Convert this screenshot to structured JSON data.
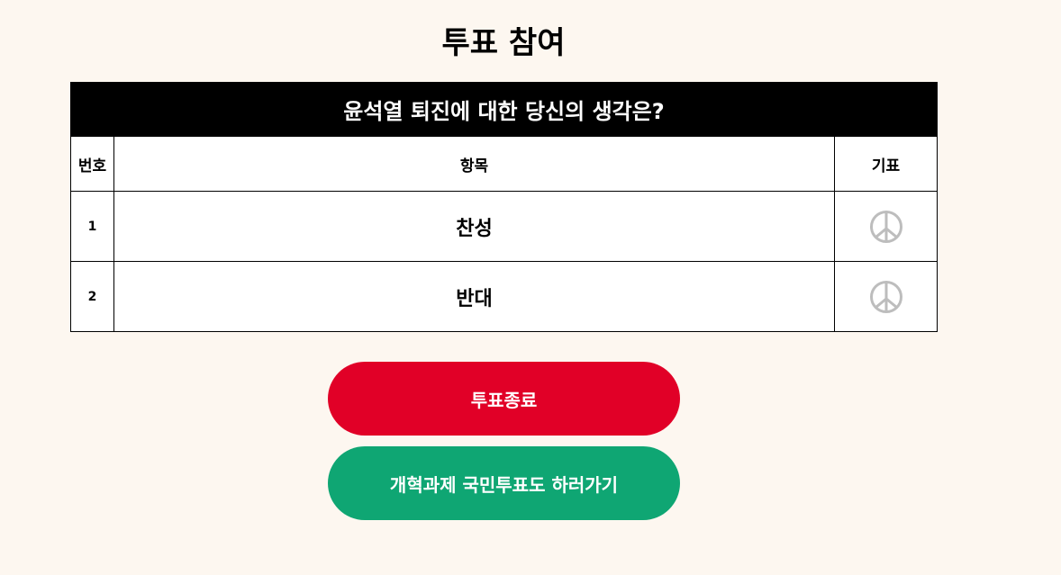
{
  "page": {
    "title": "투표 참여"
  },
  "poll": {
    "question": "윤석열 퇴진에 대한 당신의 생각은?",
    "columns": {
      "number": "번호",
      "item": "항목",
      "vote": "기표"
    },
    "options": [
      {
        "number": "1",
        "label": "찬성"
      },
      {
        "number": "2",
        "label": "반대"
      }
    ],
    "vote_icon": "ballot-stamp-icon"
  },
  "buttons": {
    "end_vote": "투표종료",
    "reform_vote": "개혁과제 국민투표도 하러가기"
  },
  "colors": {
    "background": "#fdf7f0",
    "end_button": "#e10027",
    "reform_button": "#0fa673",
    "stamp": "#bdbdbd"
  }
}
